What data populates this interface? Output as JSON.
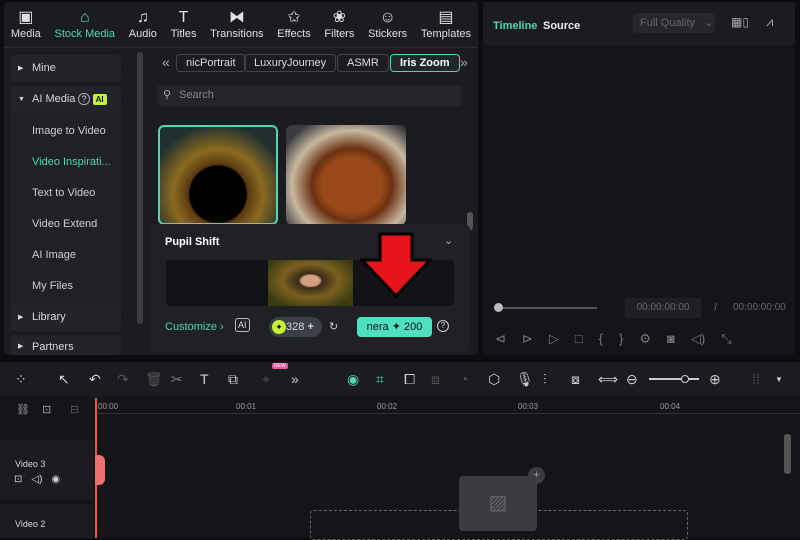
{
  "nav": [
    {
      "label": "Media",
      "icon": "media-icon",
      "glyph": "▣"
    },
    {
      "label": "Stock Media",
      "icon": "stock-media-icon",
      "glyph": "⌂",
      "active": true
    },
    {
      "label": "Audio",
      "icon": "music-icon",
      "glyph": "♫"
    },
    {
      "label": "Titles",
      "icon": "titles-icon",
      "glyph": "T"
    },
    {
      "label": "Transitions",
      "icon": "transitions-icon",
      "glyph": "⧓"
    },
    {
      "label": "Effects",
      "icon": "effects-icon",
      "glyph": "✩"
    },
    {
      "label": "Filters",
      "icon": "filters-icon",
      "glyph": "❀"
    },
    {
      "label": "Stickers",
      "icon": "stickers-icon",
      "glyph": "☺"
    },
    {
      "label": "Templates",
      "icon": "templates-icon",
      "glyph": "▤"
    }
  ],
  "sidebar": {
    "mine": "Mine",
    "ai_media": "AI Media",
    "ai_badge": "AI",
    "items": [
      "Image to Video",
      "Video Inspirati...",
      "Text to Video",
      "Video Extend",
      "AI Image",
      "My Files"
    ],
    "library": "Library",
    "partners": "Partners"
  },
  "chips": [
    "nicPortrait",
    "LuxuryJourney",
    "ASMR",
    "Iris Zoom"
  ],
  "search_placeholder": "Search",
  "popup": {
    "title": "Pupil Shift",
    "customize": "Customize",
    "credits": "328",
    "generate": "nera",
    "cost": "200"
  },
  "preview": {
    "tab_timeline": "Timeline",
    "tab_source": "Source",
    "quality": "Full Quality",
    "time_current": "00:00:00:00",
    "separator": "/",
    "time_total": "00:00:00:00"
  },
  "timeline": {
    "ticks": [
      "00:00",
      "00:01",
      "00:02",
      "00:03",
      "00:04"
    ],
    "tracks": [
      "Video 3",
      "Video 2"
    ],
    "new_badge": "NEW"
  },
  "colors": {
    "accent": "#4fd6b5",
    "arrow": "#e8141c"
  }
}
